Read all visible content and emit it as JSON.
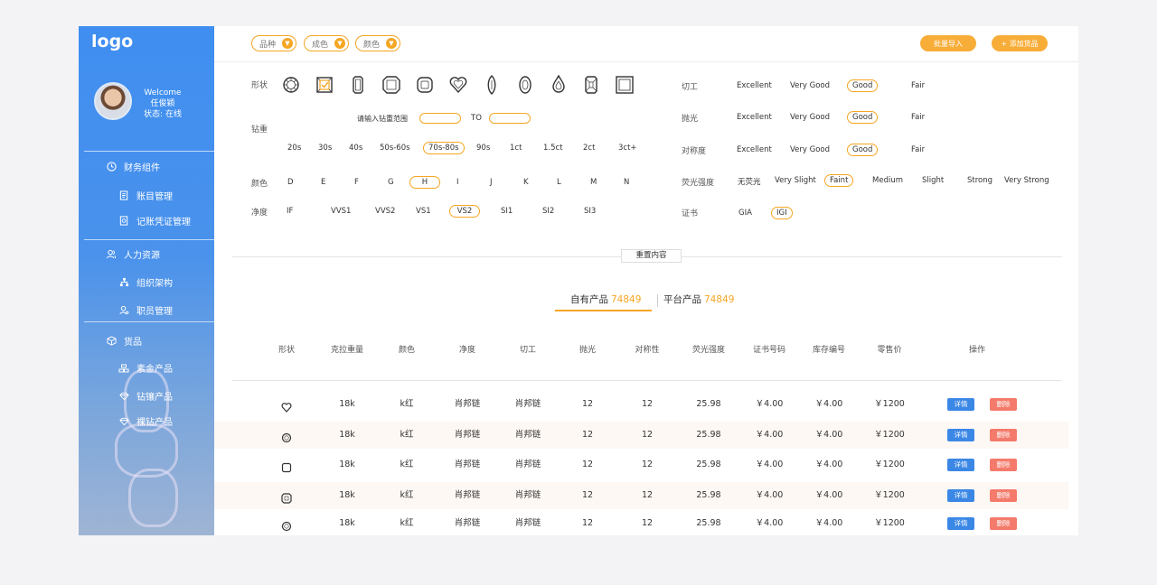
{
  "sidebar": {
    "logo": "logo",
    "welcome": "Welcome",
    "user_name": "任俊颖",
    "status": "状态: 在线",
    "groups": [
      {
        "label": "财务组件",
        "items": [
          "账目管理",
          "记账凭证管理"
        ]
      },
      {
        "label": "人力资源",
        "items": [
          "组织架构",
          "职员管理"
        ]
      },
      {
        "label": "货品",
        "items": [
          "素金产品",
          "钻镶产品",
          "裸钻产品"
        ]
      }
    ]
  },
  "topbar": {
    "selects": [
      "品种",
      "成色",
      "颜色"
    ],
    "import_label": "批量导入",
    "add_label": "+ 添加货品"
  },
  "filters": {
    "shape_label": "形状",
    "carat_label": "钻重",
    "carat_range_label": "请输入钻重范围",
    "carat_to": "TO",
    "carat_options": [
      "20s",
      "30s",
      "40s",
      "50s-60s",
      "70s-80s",
      "90s",
      "1ct",
      "1.5ct",
      "2ct",
      "3ct+"
    ],
    "carat_selected": "70s-80s",
    "color_label": "颜色",
    "color_options": [
      "D",
      "E",
      "F",
      "G",
      "H",
      "I",
      "J",
      "K",
      "L",
      "M",
      "N"
    ],
    "color_selected": "H",
    "clarity_label": "净度",
    "clarity_options": [
      "IF",
      "VVS1",
      "VVS2",
      "VS1",
      "VS2",
      "SI1",
      "SI2",
      "SI3"
    ],
    "clarity_selected": "VS2",
    "cut_label": "切工",
    "polish_label": "抛光",
    "symmetry_label": "对称度",
    "grade_options": [
      "Excellent",
      "Very Good",
      "Good",
      "Fair"
    ],
    "grade_selected": "Good",
    "fluor_label": "荧光强度",
    "fluor_options": [
      "无荧光",
      "Very Slight",
      "Faint",
      "Medium",
      "Slight",
      "Strong",
      "Very Strong"
    ],
    "fluor_selected": "Faint",
    "cert_label": "证书",
    "cert_options": [
      "GIA",
      "IGI"
    ],
    "cert_selected": "IGI",
    "reset_label": "重置内容"
  },
  "tabs": [
    {
      "label": "自有产品",
      "count": "74849"
    },
    {
      "label": "平台产品",
      "count": "74849"
    }
  ],
  "table": {
    "headers": [
      "形状",
      "克拉重量",
      "颜色",
      "净度",
      "切工",
      "抛光",
      "对称性",
      "荧光强度",
      "证书号码",
      "库存编号",
      "零售价",
      "操作"
    ],
    "rows": [
      {
        "shape": "heart",
        "carat": "18k",
        "color": "k红",
        "clarity": "肖邦链",
        "cut": "肖邦链",
        "polish": "12",
        "symmetry": "12",
        "fluor": "25.98",
        "cert": "￥4.00",
        "stock": "￥4.00",
        "price": "￥1200"
      },
      {
        "shape": "round",
        "carat": "18k",
        "color": "k红",
        "clarity": "肖邦链",
        "cut": "肖邦链",
        "polish": "12",
        "symmetry": "12",
        "fluor": "25.98",
        "cert": "￥4.00",
        "stock": "￥4.00",
        "price": "￥1200"
      },
      {
        "shape": "cushion",
        "carat": "18k",
        "color": "k红",
        "clarity": "肖邦链",
        "cut": "肖邦链",
        "polish": "12",
        "symmetry": "12",
        "fluor": "25.98",
        "cert": "￥4.00",
        "stock": "￥4.00",
        "price": "￥1200"
      },
      {
        "shape": "radiant",
        "carat": "18k",
        "color": "k红",
        "clarity": "肖邦链",
        "cut": "肖邦链",
        "polish": "12",
        "symmetry": "12",
        "fluor": "25.98",
        "cert": "￥4.00",
        "stock": "￥4.00",
        "price": "￥1200"
      },
      {
        "shape": "round",
        "carat": "18k",
        "color": "k红",
        "clarity": "肖邦链",
        "cut": "肖邦链",
        "polish": "12",
        "symmetry": "12",
        "fluor": "25.98",
        "cert": "￥4.00",
        "stock": "￥4.00",
        "price": "￥1200"
      }
    ],
    "detail_label": "详情",
    "delete_label": "删除"
  },
  "colors": {
    "accent": "#f5a623",
    "primary": "#3b87e6",
    "danger": "#f47b6b"
  }
}
